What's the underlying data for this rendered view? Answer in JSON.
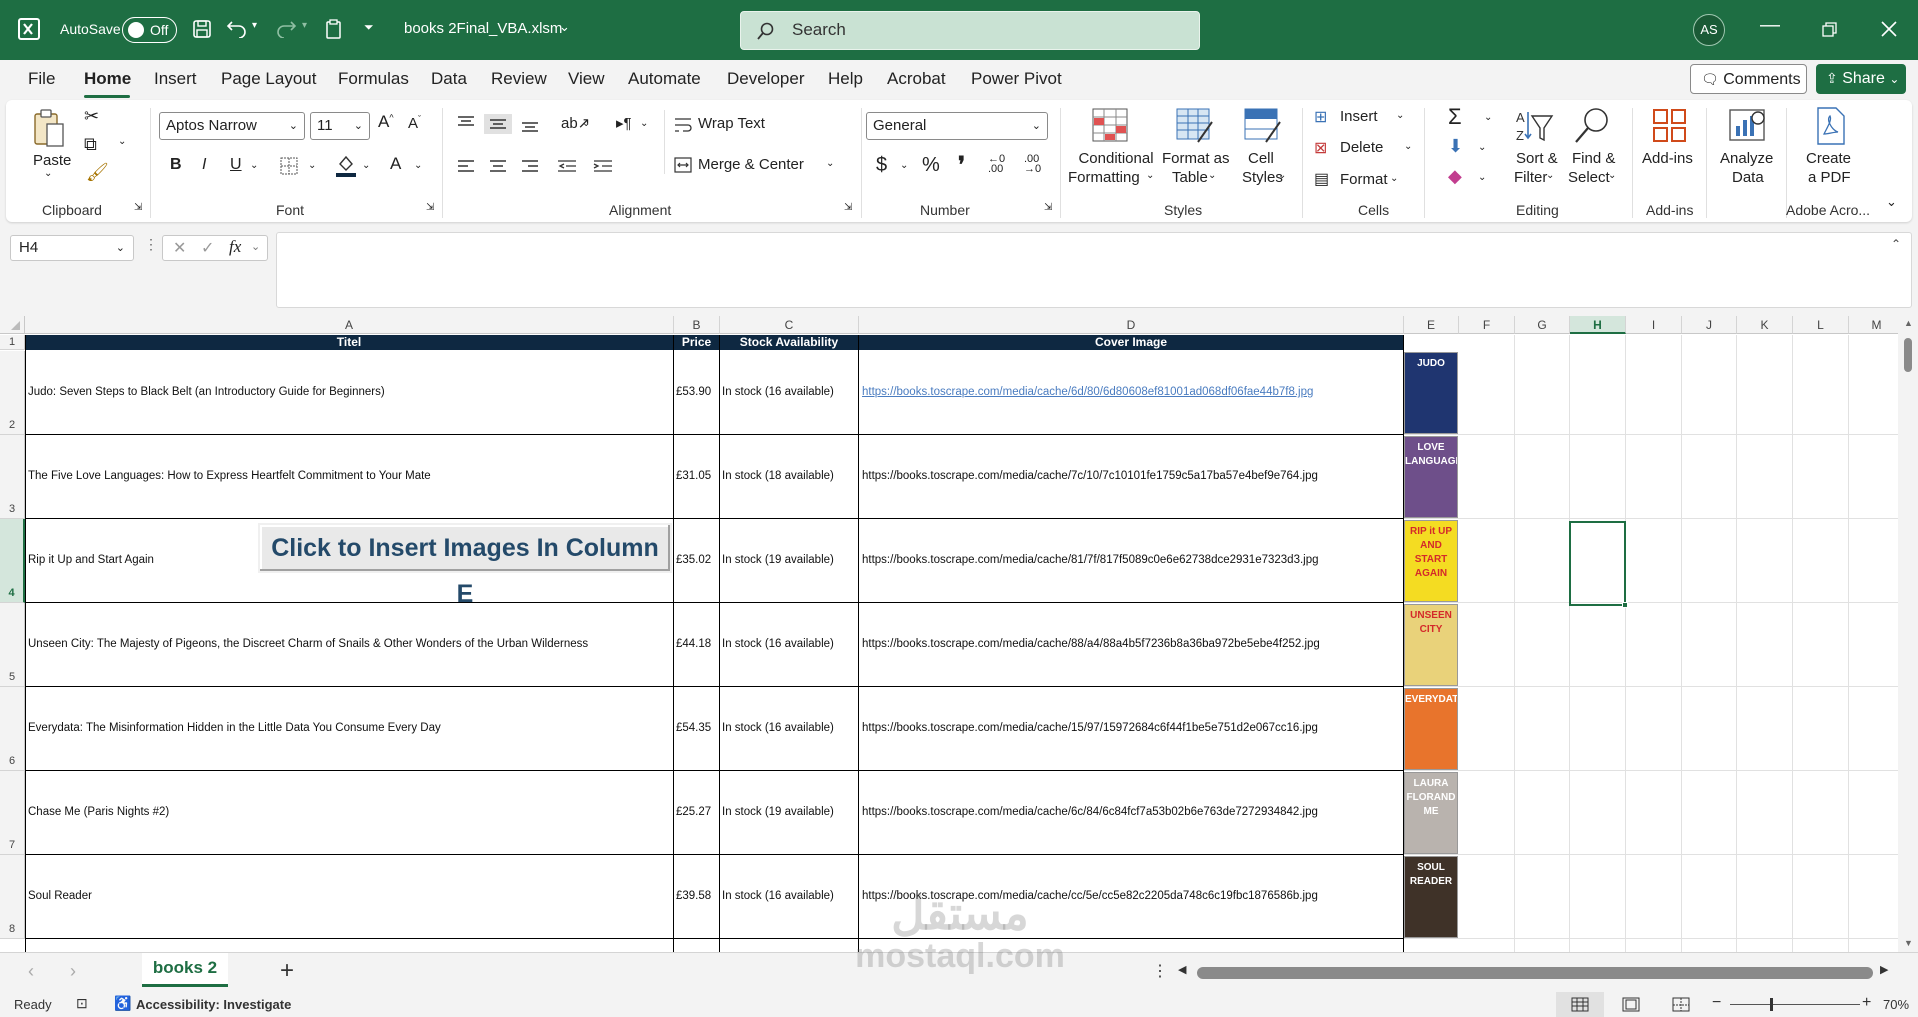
{
  "titlebar": {
    "autosave_label": "AutoSave",
    "autosave_state": "Off",
    "filename": "books 2Final_VBA.xlsm",
    "search_placeholder": "Search",
    "user_initials": "AS"
  },
  "menu": {
    "tabs": [
      "File",
      "Home",
      "Insert",
      "Page Layout",
      "Formulas",
      "Data",
      "Review",
      "View",
      "Automate",
      "Developer",
      "Help",
      "Acrobat",
      "Power Pivot"
    ],
    "active": "Home",
    "comments_label": "Comments",
    "share_label": "Share"
  },
  "ribbon": {
    "clipboard": {
      "paste_label": "Paste",
      "group": "Clipboard"
    },
    "font": {
      "name": "Aptos Narrow",
      "size": "11",
      "group": "Font"
    },
    "alignment": {
      "wrap_text": "Wrap Text",
      "merge_center": "Merge & Center",
      "group": "Alignment"
    },
    "number": {
      "format": "General",
      "group": "Number"
    },
    "styles": {
      "conditional_formatting": [
        "Conditional",
        "Formatting"
      ],
      "format_as_table": [
        "Format as",
        "Table"
      ],
      "cell_styles": [
        "Cell",
        "Styles"
      ],
      "group": "Styles"
    },
    "cells": {
      "insert": "Insert",
      "delete": "Delete",
      "format": "Format",
      "group": "Cells"
    },
    "editing": {
      "sort_filter": [
        "Sort &",
        "Filter"
      ],
      "find_select": [
        "Find &",
        "Select"
      ],
      "group": "Editing"
    },
    "addins": {
      "label": "Add-ins",
      "group": "Add-ins"
    },
    "analyze": {
      "label": [
        "Analyze",
        "Data"
      ]
    },
    "acrobat": {
      "label": [
        "Create",
        "a PDF"
      ],
      "group": "Adobe Acro..."
    }
  },
  "formula_bar": {
    "name_box": "H4",
    "fx": "fx",
    "content": ""
  },
  "sheet": {
    "columns": [
      "A",
      "B",
      "C",
      "D",
      "E",
      "F",
      "G",
      "H",
      "I",
      "J",
      "K",
      "L",
      "M"
    ],
    "selected_column": "H",
    "selected_row": "4",
    "headers": {
      "A": "Titel",
      "B": "Price",
      "C": "Stock Availability",
      "D": "Cover Image"
    },
    "rows": [
      {
        "num": "2",
        "title": "Judo: Seven Steps to Black Belt (an Introductory Guide for Beginners)",
        "price": "£53.90",
        "stock": "In stock (16 available)",
        "url": "https://books.toscrape.com/media/cache/6d/80/6d80608ef81001ad068df06fae44b7f8.jpg",
        "cover": "JUDO",
        "cover_color": "#1f3570"
      },
      {
        "num": "3",
        "title": "The Five Love Languages: How to Express Heartfelt Commitment to Your Mate",
        "price": "£31.05",
        "stock": "In stock (18 available)",
        "url": "https://books.toscrape.com/media/cache/7c/10/7c10101fe1759c5a17ba57e4bef9e764.jpg",
        "cover": "LOVE LANGUAGES",
        "cover_color": "#6e4f8a"
      },
      {
        "num": "4",
        "title": "Rip it Up and Start Again",
        "price": "£35.02",
        "stock": "In stock (19 available)",
        "url": "https://books.toscrape.com/media/cache/81/7f/817f5089c0e6e62738dce2931e7323d3.jpg",
        "cover": "RIP it UP AND START AGAIN",
        "cover_color": "#f4dc22"
      },
      {
        "num": "5",
        "title": "Unseen City: The Majesty of Pigeons, the Discreet Charm of Snails & Other Wonders of the Urban Wilderness",
        "price": "£44.18",
        "stock": "In stock (16 available)",
        "url": "https://books.toscrape.com/media/cache/88/a4/88a4b5f7236b8a36ba972be5ebe4f252.jpg",
        "cover": "UNSEEN CITY",
        "cover_color": "#e9d27a"
      },
      {
        "num": "6",
        "title": "Everydata: The Misinformation Hidden in the Little Data You Consume Every Day",
        "price": "£54.35",
        "stock": "In stock (16 available)",
        "url": "https://books.toscrape.com/media/cache/15/97/15972684c6f44f1be5e751d2e067cc16.jpg",
        "cover": "EVERYDATA",
        "cover_color": "#e8742c"
      },
      {
        "num": "7",
        "title": "Chase Me (Paris Nights #2)",
        "price": "£25.27",
        "stock": "In stock (19 available)",
        "url": "https://books.toscrape.com/media/cache/6c/84/6c84fcf7a53b02b6e763de7272934842.jpg",
        "cover": "LAURA FLORAND ME",
        "cover_color": "#b9b3ae"
      },
      {
        "num": "8",
        "title": "Soul Reader",
        "price": "£39.58",
        "stock": "In stock (16 available)",
        "url": "https://books.toscrape.com/media/cache/cc/5e/cc5e82c2205da748c6c19fbc1876586b.jpg",
        "cover": "SOUL READER",
        "cover_color": "#3f3228"
      }
    ],
    "macro_button": "Click to Insert Images In Column E"
  },
  "sheet_tabs": {
    "active": "books 2",
    "add": "+"
  },
  "status": {
    "ready": "Ready",
    "accessibility": "Accessibility: Investigate",
    "zoom": "70%"
  },
  "watermark": {
    "line1": "مستقل",
    "line2": "mostaql.com"
  }
}
